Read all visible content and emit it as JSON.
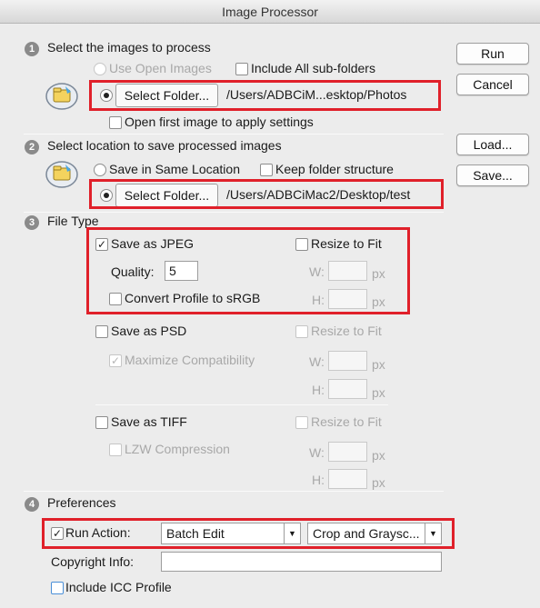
{
  "window": {
    "title": "Image Processor"
  },
  "actions": {
    "run": "Run",
    "cancel": "Cancel",
    "load": "Load...",
    "save": "Save..."
  },
  "section1": {
    "step": "1",
    "heading": "Select the images to process",
    "use_open_images": "Use Open Images",
    "include_subfolders": "Include All sub-folders",
    "select_folder": "Select Folder...",
    "folder_path": "/Users/ADBCiM...esktop/Photos",
    "open_first_image": "Open first image to apply settings"
  },
  "section2": {
    "step": "2",
    "heading": "Select location to save processed images",
    "save_same_location": "Save in Same Location",
    "keep_folder_structure": "Keep folder structure",
    "select_folder": "Select Folder...",
    "folder_path": "/Users/ADBCiMac2/Desktop/test"
  },
  "section3": {
    "step": "3",
    "heading": "File Type",
    "jpeg": {
      "save_as": "Save as JPEG",
      "checked": true,
      "resize": "Resize to Fit",
      "quality_label": "Quality:",
      "quality_value": "5",
      "convert_profile": "Convert Profile to sRGB",
      "w_label": "W:",
      "h_label": "H:",
      "unit": "px"
    },
    "psd": {
      "save_as": "Save as PSD",
      "resize": "Resize to Fit",
      "maximize": "Maximize Compatibility",
      "w_label": "W:",
      "h_label": "H:",
      "unit": "px"
    },
    "tiff": {
      "save_as": "Save as TIFF",
      "resize": "Resize to Fit",
      "lzw": "LZW Compression",
      "w_label": "W:",
      "h_label": "H:",
      "unit": "px"
    }
  },
  "section4": {
    "step": "4",
    "heading": "Preferences",
    "run_action": "Run Action:",
    "run_action_checked": true,
    "action_set": "Batch Edit",
    "action": "Crop and Graysc...",
    "copyright_label": "Copyright Info:",
    "copyright_value": "",
    "include_icc": "Include ICC Profile"
  },
  "colors": {
    "highlight": "#e0202a",
    "background": "#ececec"
  },
  "icons": {
    "step": "numbered-circle",
    "droplet": "photoshop-folder-icon",
    "select_arrow": "chevron-down-icon"
  }
}
